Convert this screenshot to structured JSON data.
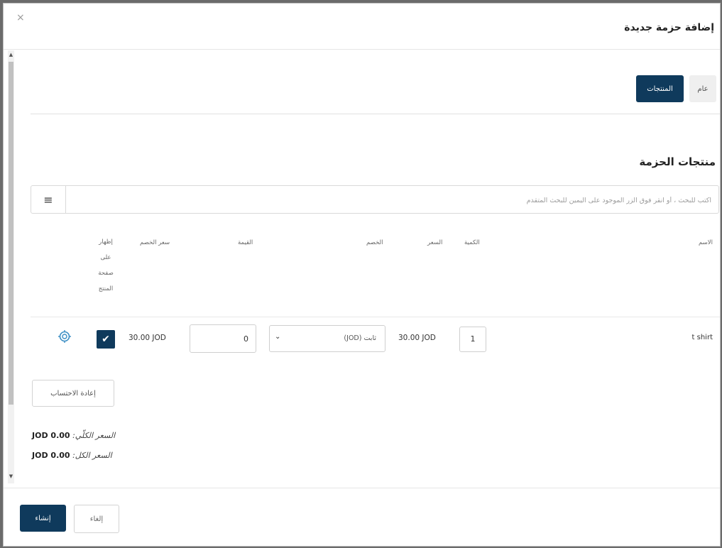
{
  "dialog": {
    "close_icon_glyph": "×",
    "title": "إضافة حزمة جديدة"
  },
  "tabs": [
    {
      "label": "المنتجات",
      "active": true
    },
    {
      "label": "عام",
      "active": false
    }
  ],
  "section": {
    "title": "منتجات الحزمة"
  },
  "search": {
    "placeholder": "اكتب للبحث ، أو انقر فوق الزر الموجود على اليمين للبحث المتقدم",
    "menu_icon_glyph": "≡"
  },
  "table": {
    "headers": {
      "name": "الاسم",
      "quantity": "الكمية",
      "price": "السعر",
      "discount": "الخصم",
      "value": "القيمة",
      "discount_price": "سعر الخصم",
      "show_on_product_page": [
        "إظهار",
        "على",
        "صفحة",
        "المنتج"
      ]
    },
    "rows": [
      {
        "name": "t shirt",
        "quantity": "1",
        "price": "30.00 JOD",
        "discount_type": "ثابت (JOD)",
        "value": "0",
        "discount_price": "30.00 JOD",
        "show_on_product_page": true,
        "check_glyph": "✔",
        "chevron_glyph": "⌄"
      }
    ]
  },
  "actions": {
    "recalculate_label": "إعادة الاحتساب",
    "create_label": "إنشاء",
    "cancel_label": "إلغاء"
  },
  "totals": {
    "overall_label": "السعر الكلّي:",
    "overall_value": "0.00 JOD",
    "total_label": "السعر الكل:",
    "total_value": "0.00 JOD"
  },
  "colors": {
    "primary": "#0f3a5c",
    "tab_inactive": "#efefef"
  }
}
